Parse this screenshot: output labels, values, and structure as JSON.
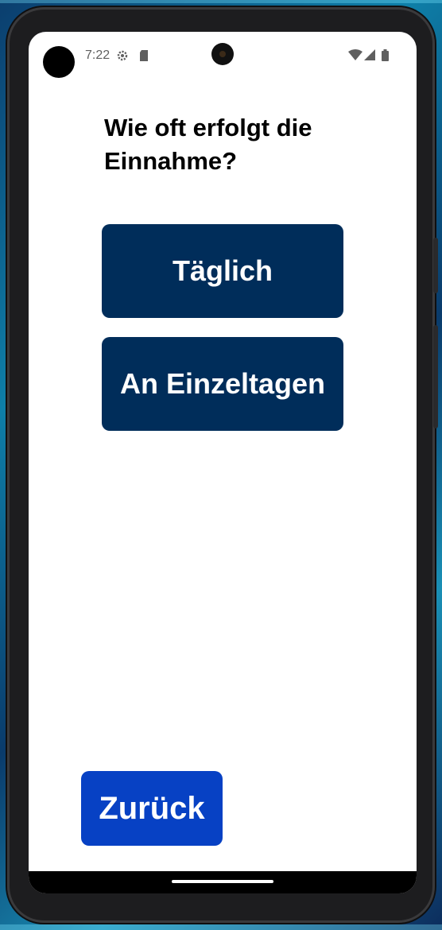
{
  "status_bar": {
    "time": "7:22",
    "icons": [
      "settings-icon",
      "sd-card-icon",
      "wifi-icon",
      "signal-icon",
      "battery-icon"
    ]
  },
  "question": "Wie oft erfolgt die Einnahme?",
  "options": [
    {
      "label": "Täglich"
    },
    {
      "label": "An Einzeltagen"
    }
  ],
  "back_button": {
    "label": "Zurück"
  },
  "colors": {
    "option_button": "#002d5a",
    "back_button": "#0741c4",
    "screen_background": "#ffffff"
  }
}
